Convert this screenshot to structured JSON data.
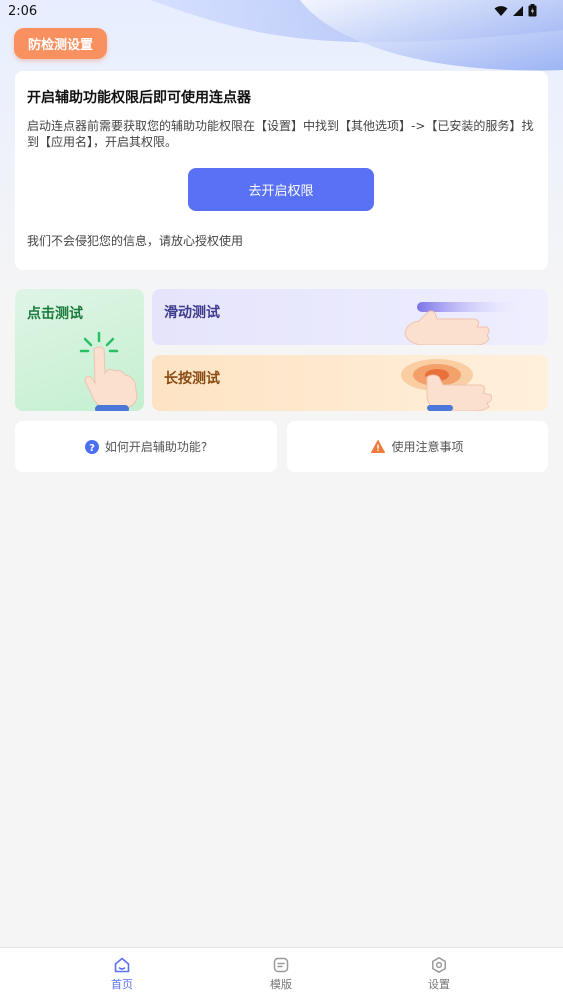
{
  "statusbar": {
    "time": "2:06"
  },
  "header": {
    "anti_detect_label": "防检测设置"
  },
  "permission": {
    "title": "开启辅助功能权限后即可使用连点器",
    "description": "启动连点器前需要获取您的辅助功能权限在【设置】中找到【其他选项】->【已安装的服务】找到【应用名】，开启其权限。",
    "button_label": "去开启权限",
    "note": "我们不会侵犯您的信息，请放心授权使用"
  },
  "tests": {
    "click": "点击测试",
    "slide": "滑动测试",
    "long_press": "长按测试"
  },
  "help": {
    "how_to": "如何开启辅助功能?",
    "notice": "使用注意事项"
  },
  "tabs": [
    {
      "label": "首页",
      "icon": "home-icon",
      "active": true
    },
    {
      "label": "模版",
      "icon": "template-icon",
      "active": false
    },
    {
      "label": "设置",
      "icon": "settings-icon",
      "active": false
    }
  ],
  "colors": {
    "accent": "#5871f5",
    "anti_detect": "#f99060",
    "click_test": "#c4efd0",
    "slide_test": "#e5e4fb",
    "press_test": "#fde3c4"
  }
}
